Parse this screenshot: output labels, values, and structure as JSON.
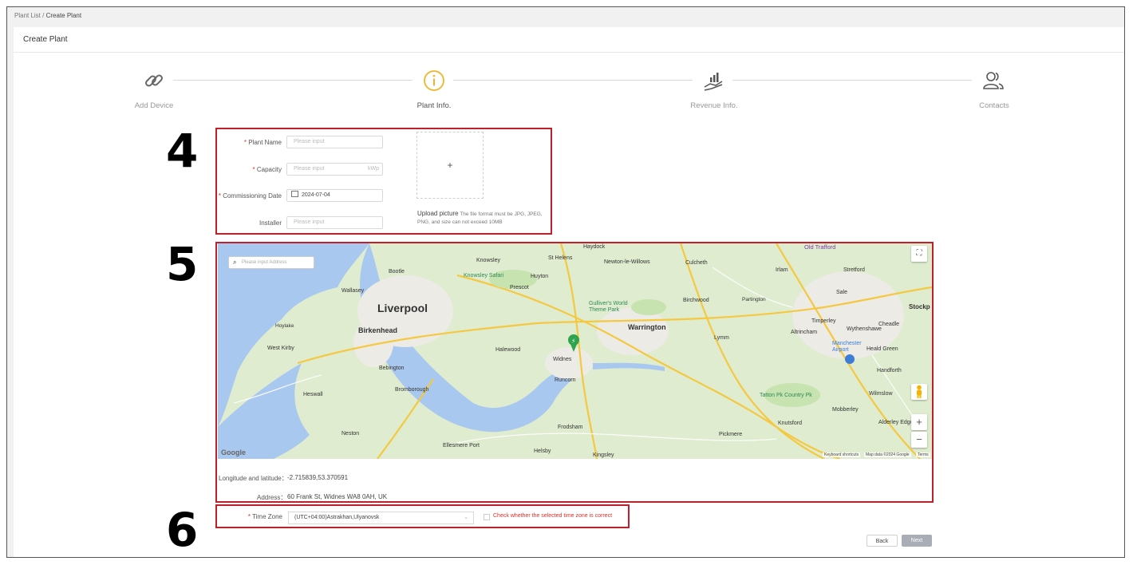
{
  "breadcrumb": {
    "parent": "Plant List",
    "separator": "/",
    "current": "Create Plant"
  },
  "page_title": "Create Plant",
  "steps": [
    {
      "label": "Add Device",
      "icon": "link-icon",
      "active": false
    },
    {
      "label": "Plant Info.",
      "icon": "info-circle-icon",
      "active": true
    },
    {
      "label": "Revenue Info.",
      "icon": "revenue-hand-icon",
      "active": false
    },
    {
      "label": "Contacts",
      "icon": "contacts-icon",
      "active": false
    }
  ],
  "annotations": [
    "4",
    "5",
    "6"
  ],
  "form": {
    "plant_name": {
      "required": "*",
      "label": "Plant Name",
      "placeholder": "Please input"
    },
    "capacity": {
      "required": "*",
      "label": "Capacity",
      "placeholder": "Please input",
      "unit": "kWp"
    },
    "commissioning_date": {
      "required": "*",
      "label": "Commissioning Date",
      "value": "2024-07-04",
      "icon": "calendar-icon"
    },
    "installer": {
      "label": "Installer",
      "placeholder": "Please input"
    },
    "upload": {
      "plus": "+",
      "title": "Upload picture",
      "hint": "The file format must be JPG, JPEG, PNG, and size can not exceed 10MB"
    }
  },
  "map": {
    "search_placeholder": "Please input Address",
    "places": {
      "liverpool": "Liverpool",
      "birkenhead": "Birkenhead",
      "warrington": "Warrington",
      "widnes": "Widnes",
      "runcorn": "Runcorn",
      "st_helens": "St Helens",
      "knowsley": "Knowsley",
      "prescot": "Prescot",
      "halewood": "Halewood",
      "frodsham": "Frodsham",
      "heswall": "Heswall",
      "wallasey": "Wallasey",
      "west_kirby": "West Kirby",
      "hoylake": "Hoylake",
      "bromborough": "Bromborough",
      "neston": "Neston",
      "ellesmere_port": "Ellesmere Port",
      "knutsford": "Knutsford",
      "altrincham": "Altrincham",
      "sale": "Sale",
      "stretford": "Stretford",
      "old_trafford": "Old Trafford",
      "manchester_airport": "Manchester Airport",
      "cheadle": "Cheadle",
      "stockport": "Stockp",
      "tatton": "Tatton Pk Country Pk",
      "wilmslow": "Wilmslow",
      "lymm": "Lymm",
      "birchwood": "Birchwood",
      "culcheth": "Culcheth",
      "newton": "Newton-le-Willows",
      "haydock": "Haydock",
      "gullivers": "Gulliver's World Theme Park",
      "knowsley_safari": "Knowsley Safari",
      "timperley": "Timperley",
      "irlam": "Irlam",
      "partington": "Partington",
      "mobberley": "Mobberley",
      "handforth": "Handforth",
      "helsby": "Helsby",
      "kingsley": "Kingsley",
      "pickmere": "Pickmere",
      "bootle": "Bootle",
      "huyton": "Huyton",
      "bebington": "Bebington",
      "heald_green": "Heald Green",
      "wythenshawe": "Wythenshawe",
      "alderley_edge": "Alderley Edge"
    },
    "attribution": {
      "shortcuts": "Keyboard shortcuts",
      "data": "Map data ©2024 Google",
      "terms": "Terms"
    },
    "google_logo": "Google",
    "zoom_in": "+",
    "zoom_out": "−",
    "fullscreen": "⛶",
    "pegman": "pegman-icon",
    "marker": "pin-icon"
  },
  "location": {
    "lonlat_label": "Longitude and latitude：",
    "lonlat_value": "-2.715839,53.370591",
    "address_label": "Address：",
    "address_value": "60 Frank St, Widnes WA8 0AH, UK"
  },
  "timezone": {
    "required": "*",
    "label": "Time Zone",
    "value": "(UTC+04:00)Astrakhan,Ulyanovsk",
    "check_label": "Check whether the selected time zone is correct"
  },
  "buttons": {
    "back": "Back",
    "next": "Next"
  },
  "colors": {
    "annotation_red": "#c0202a",
    "active_step": "#f0b429",
    "required": "#e0302a",
    "water": "#a9c8f0",
    "land": "#dfeccf",
    "road": "#f5c842"
  }
}
